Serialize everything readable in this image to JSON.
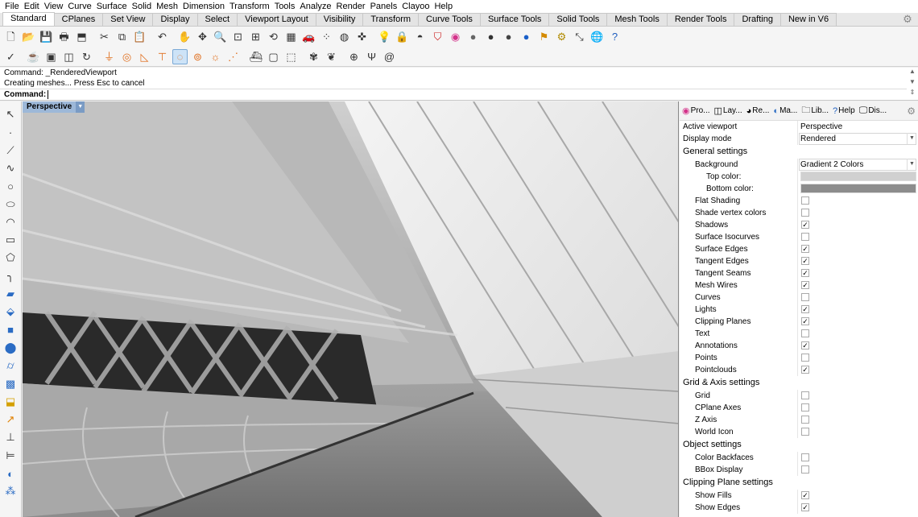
{
  "menubar": [
    "File",
    "Edit",
    "View",
    "Curve",
    "Surface",
    "Solid",
    "Mesh",
    "Dimension",
    "Transform",
    "Tools",
    "Analyze",
    "Render",
    "Panels",
    "Clayoo",
    "Help"
  ],
  "tabs": [
    "Standard",
    "CPlanes",
    "Set View",
    "Display",
    "Select",
    "Viewport Layout",
    "Visibility",
    "Transform",
    "Curve Tools",
    "Surface Tools",
    "Solid Tools",
    "Mesh Tools",
    "Render Tools",
    "Drafting",
    "New in V6"
  ],
  "active_tab": "Standard",
  "toolbar1_icons": [
    "new-file-icon",
    "open-file-icon",
    "save-icon",
    "print-icon",
    "import-icon",
    "cut-icon",
    "copy-icon",
    "paste-icon",
    "undo-icon",
    "pan-hand-icon",
    "move-icon",
    "zoom-icon",
    "zoom-window-icon",
    "zoom-extents-icon",
    "rotate-view-icon",
    "four-view-icon",
    "car-icon",
    "select-point-icon",
    "cplane-icon",
    "move-axis-icon",
    "light-bulb-icon",
    "lock-icon",
    "hide-icon",
    "shield-icon",
    "color-wheel-icon",
    "sphere-render-icon",
    "sphere-dark-icon",
    "sphere-dark2-icon",
    "sphere-blue-icon",
    "flag-icon",
    "gear-cluster-icon",
    "transform-icon",
    "globe-icon",
    "help-icon"
  ],
  "toolbar2_icons": [
    "check-icon",
    "teapot-icon",
    "cube-stack-icon",
    "layers-icon",
    "rotate-icon",
    "funnel-icon",
    "ring-icon",
    "triangle-icon",
    "pin-icon",
    "ring-outline-icon",
    "circle-pattern-icon",
    "sun-icon",
    "crossed-lines-icon",
    "boat-icon",
    "box-icon",
    "box-open-icon",
    "plant-icon",
    "leaf-icon",
    "globe-grid-icon",
    "tree-icon",
    "spiral-icon"
  ],
  "toolbar2_selected_icon": "ring-outline-icon",
  "command": {
    "history": [
      "Command: _RenderedViewport",
      "Creating meshes... Press Esc to cancel"
    ],
    "prompt": "Command:"
  },
  "left_toolbar_icons": [
    "select-arrow-icon",
    "point-icon",
    "polyline-icon",
    "curve-icon",
    "circle-icon",
    "ellipse-icon",
    "arc-icon",
    "rectangle-icon",
    "polygon-icon",
    "fillet-icon",
    "surface-icon",
    "extrude-icon",
    "box-solid-icon",
    "sphere-solid-icon",
    "cylinder-icon",
    "mesh-icon",
    "boolean-icon",
    "arrow-transform-icon",
    "align-icon",
    "distribute-icon",
    "material-icon",
    "group-icon"
  ],
  "viewport": {
    "name": "Perspective"
  },
  "panel": {
    "tabs": [
      {
        "icon": "color-wheel-icon",
        "label": "Pro..."
      },
      {
        "icon": "layers-icon",
        "label": "Lay..."
      },
      {
        "icon": "render-icon",
        "label": "Re..."
      },
      {
        "icon": "material-icon",
        "label": "Ma..."
      },
      {
        "icon": "folder-icon",
        "label": "Lib..."
      },
      {
        "icon": "help-icon",
        "label": "Help"
      },
      {
        "icon": "display-icon",
        "label": "Dis..."
      }
    ],
    "active_viewport_label": "Active viewport",
    "active_viewport_value": "Perspective",
    "display_mode_label": "Display mode",
    "display_mode_value": "Rendered",
    "sections": {
      "general": "General settings",
      "grid": "Grid & Axis settings",
      "object": "Object settings",
      "clipping": "Clipping Plane settings"
    },
    "background_label": "Background",
    "background_value": "Gradient 2 Colors",
    "top_color_label": "Top color:",
    "top_color_value": "#d0d0d0",
    "bottom_color_label": "Bottom color:",
    "bottom_color_value": "#8c8c8c",
    "general_items": [
      {
        "label": "Flat Shading",
        "checked": false
      },
      {
        "label": "Shade vertex colors",
        "checked": false
      },
      {
        "label": "Shadows",
        "checked": true
      },
      {
        "label": "Surface Isocurves",
        "checked": false
      },
      {
        "label": "Surface Edges",
        "checked": true
      },
      {
        "label": "Tangent Edges",
        "checked": true
      },
      {
        "label": "Tangent Seams",
        "checked": true
      },
      {
        "label": "Mesh Wires",
        "checked": true
      },
      {
        "label": "Curves",
        "checked": false
      },
      {
        "label": "Lights",
        "checked": true
      },
      {
        "label": "Clipping Planes",
        "checked": true
      },
      {
        "label": "Text",
        "checked": false
      },
      {
        "label": "Annotations",
        "checked": true
      },
      {
        "label": "Points",
        "checked": false
      },
      {
        "label": "Pointclouds",
        "checked": true
      }
    ],
    "grid_items": [
      {
        "label": "Grid",
        "checked": false
      },
      {
        "label": "CPlane Axes",
        "checked": false
      },
      {
        "label": "Z Axis",
        "checked": false
      },
      {
        "label": "World Icon",
        "checked": false
      }
    ],
    "object_items": [
      {
        "label": "Color Backfaces",
        "checked": false
      },
      {
        "label": "BBox Display",
        "checked": false
      }
    ],
    "clipping_items": [
      {
        "label": "Show Fills",
        "checked": true
      },
      {
        "label": "Show Edges",
        "checked": true
      }
    ]
  }
}
